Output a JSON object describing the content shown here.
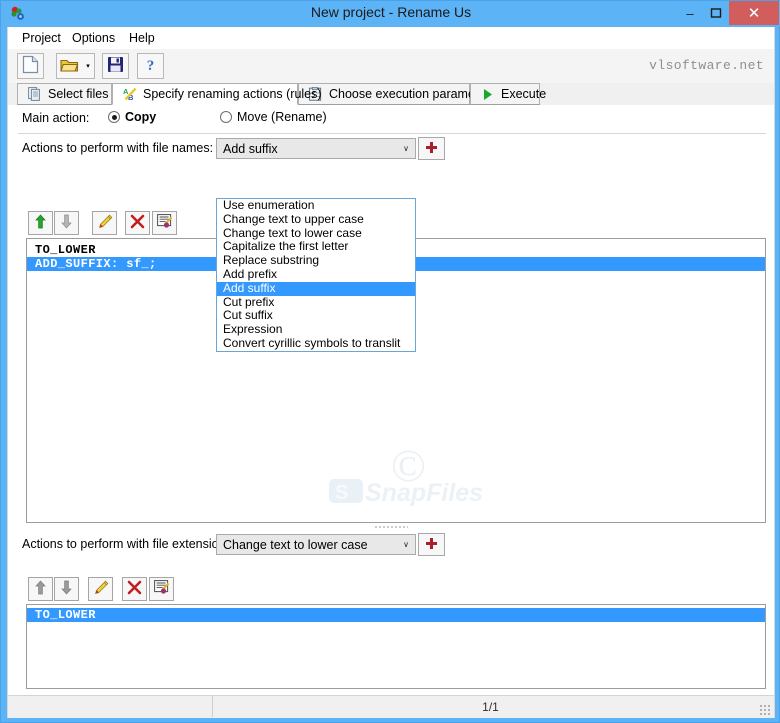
{
  "window": {
    "title": "New project - Rename Us",
    "app_icon": "app-logo-icon",
    "minimize_label": "–",
    "maximize_label": "❐",
    "close_label": "✕",
    "titlebar_color": "#5cb3f5",
    "close_color": "#d15d5d"
  },
  "menubar": {
    "items": [
      {
        "label": "Project"
      },
      {
        "label": "Options"
      },
      {
        "label": "Help"
      }
    ]
  },
  "toolbar": {
    "buttons": [
      {
        "name": "new-project-button",
        "icon": "new-document-icon"
      },
      {
        "name": "open-project-button",
        "icon": "open-folder-icon"
      },
      {
        "name": "save-project-button",
        "icon": "floppy-save-icon"
      },
      {
        "name": "help-button",
        "icon": "question-mark-icon"
      }
    ],
    "dropdown_arrow": "▾",
    "brand": "vlsoftware.net"
  },
  "tabs": [
    {
      "label": "Select files",
      "icon": "documents-icon",
      "active": false
    },
    {
      "label": "Specify renaming actions (rules)",
      "icon": "ab-letters-icon",
      "active": true
    },
    {
      "label": "Choose execution parameters",
      "icon": "checklist-icon",
      "active": false
    },
    {
      "label": "Execute",
      "icon": "green-play-icon",
      "active": false
    }
  ],
  "main_action": {
    "label": "Main action:",
    "options": [
      {
        "label": "Copy",
        "selected": true
      },
      {
        "label": "Move (Rename)",
        "selected": false
      }
    ]
  },
  "names_section": {
    "label": "Actions to perform with file names:",
    "combo_value": "Add suffix",
    "combo_arrow": "∨",
    "add_button": "+",
    "toolbar_buttons": [
      {
        "name": "move-up-button",
        "icon": "arrow-up-icon"
      },
      {
        "name": "move-down-button",
        "icon": "arrow-down-icon"
      },
      {
        "name": "edit-rule-button",
        "icon": "pencil-icon"
      },
      {
        "name": "delete-rule-button",
        "icon": "red-x-icon"
      },
      {
        "name": "edit-properties-button",
        "icon": "properties-icon"
      }
    ],
    "rules": [
      {
        "text": "TO_LOWER",
        "selected": false
      },
      {
        "text": "ADD_SUFFIX: sf_;",
        "selected": true
      }
    ]
  },
  "dropdown": {
    "open": true,
    "items": [
      {
        "label": "Use enumeration",
        "selected": false
      },
      {
        "label": "Change text to upper case",
        "selected": false
      },
      {
        "label": "Change text to lower case",
        "selected": false
      },
      {
        "label": "Capitalize the first letter",
        "selected": false
      },
      {
        "label": "Replace substring",
        "selected": false
      },
      {
        "label": "Add prefix",
        "selected": false
      },
      {
        "label": "Add suffix",
        "selected": true
      },
      {
        "label": "Cut prefix",
        "selected": false
      },
      {
        "label": "Cut suffix",
        "selected": false
      },
      {
        "label": "Expression",
        "selected": false
      },
      {
        "label": "Convert cyrillic symbols to translit",
        "selected": false
      }
    ]
  },
  "extensions_section": {
    "label": "Actions to perform with file extensions:",
    "combo_value": "Change text to lower case",
    "combo_arrow": "∨",
    "add_button": "+",
    "toolbar_buttons": [
      {
        "name": "move-up-button",
        "icon": "arrow-up-icon"
      },
      {
        "name": "move-down-button",
        "icon": "arrow-down-icon"
      },
      {
        "name": "edit-rule-button",
        "icon": "pencil-icon"
      },
      {
        "name": "delete-rule-button",
        "icon": "red-x-icon"
      },
      {
        "name": "edit-properties-button",
        "icon": "properties-icon"
      }
    ],
    "rules": [
      {
        "text": "TO_LOWER",
        "selected": true
      }
    ]
  },
  "watermark": {
    "text": "SnapFiles",
    "symbol": "©"
  },
  "statusbar": {
    "left_text": "",
    "center_text": "1/1"
  },
  "colors": {
    "selection": "#3399ff",
    "accent": "#5cb3f5",
    "close": "#d15d5d"
  }
}
